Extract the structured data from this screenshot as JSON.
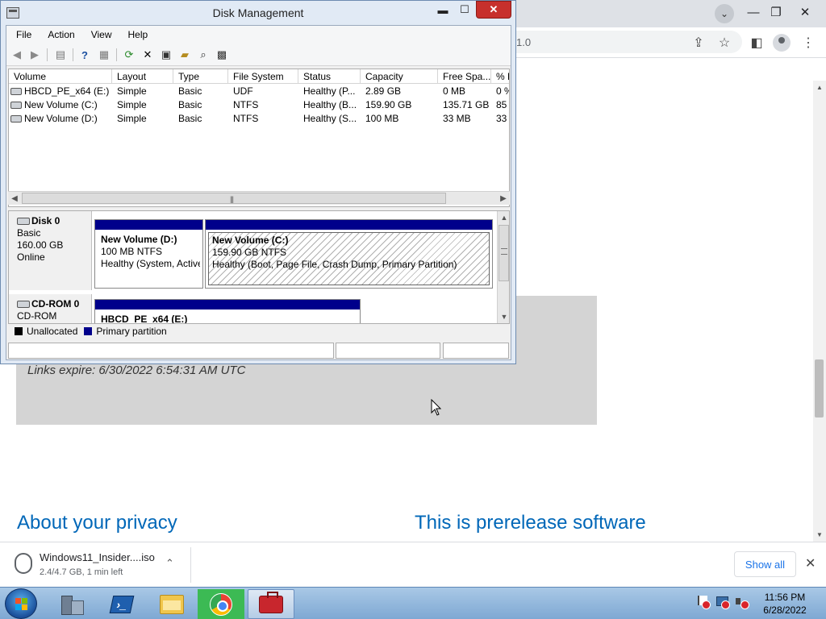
{
  "browser": {
    "address_text": "1.0",
    "links_expire": "Links expire: 6/30/2022 6:54:31 AM UTC",
    "privacy_heading": "About your privacy",
    "prerelease_heading": "This is prerelease software",
    "download": {
      "file_name": "Windows11_Insider....iso",
      "status": "2.4/4.7 GB, 1 min left",
      "show_all_label": "Show all"
    }
  },
  "disk_mgmt": {
    "title": "Disk Management",
    "menu": [
      "File",
      "Action",
      "View",
      "Help"
    ],
    "columns": [
      "Volume",
      "Layout",
      "Type",
      "File System",
      "Status",
      "Capacity",
      "Free Spa...",
      "% F"
    ],
    "volumes": [
      {
        "volume": "HBCD_PE_x64 (E:)",
        "layout": "Simple",
        "type": "Basic",
        "fs": "UDF",
        "status": "Healthy (P...",
        "capacity": "2.89 GB",
        "free": "0 MB",
        "pct": "0 %"
      },
      {
        "volume": "New Volume (C:)",
        "layout": "Simple",
        "type": "Basic",
        "fs": "NTFS",
        "status": "Healthy (B...",
        "capacity": "159.90 GB",
        "free": "135.71 GB",
        "pct": "85"
      },
      {
        "volume": "New Volume (D:)",
        "layout": "Simple",
        "type": "Basic",
        "fs": "NTFS",
        "status": "Healthy (S...",
        "capacity": "100 MB",
        "free": "33 MB",
        "pct": "33"
      }
    ],
    "disks": [
      {
        "name": "Disk 0",
        "kind": "Basic",
        "size": "160.00 GB",
        "state": "Online",
        "partitions": [
          {
            "name": "New Volume  (D:)",
            "size": "100 MB NTFS",
            "status": "Healthy (System, Active, Primary Partition)"
          },
          {
            "name": "New Volume  (C:)",
            "size": "159.90 GB NTFS",
            "status": "Healthy (Boot, Page File, Crash Dump, Primary Partition)"
          }
        ]
      },
      {
        "name": "CD-ROM 0",
        "kind": "CD-ROM",
        "partitions": [
          {
            "name": "HBCD_PE_x64  (E:)"
          }
        ]
      }
    ],
    "legend": {
      "unallocated": "Unallocated",
      "primary": "Primary partition",
      "unallocated_color": "#000000",
      "primary_color": "#00008b"
    }
  },
  "taskbar": {
    "time": "11:56 PM",
    "date": "6/28/2022",
    "apps": [
      "server-manager-icon",
      "powershell-icon",
      "file-explorer-icon",
      "chrome-icon",
      "toolbox-icon"
    ]
  }
}
